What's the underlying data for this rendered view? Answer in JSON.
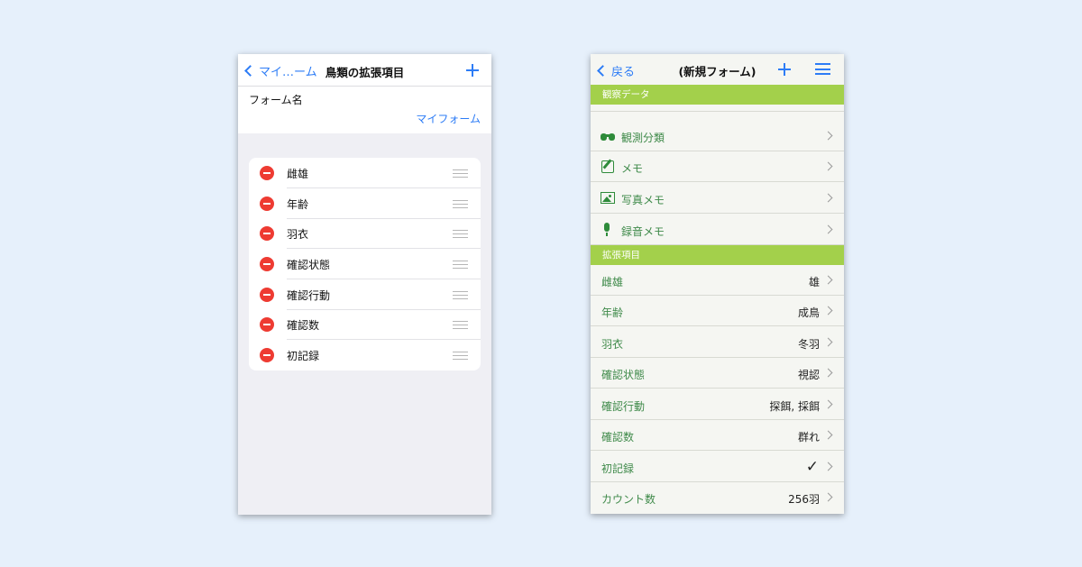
{
  "left": {
    "nav": {
      "back_label": "マイ…ーム",
      "title": "鳥類の拡張項目"
    },
    "form": {
      "label": "フォーム名",
      "value": "マイフォーム"
    },
    "items": [
      {
        "label": "雌雄"
      },
      {
        "label": "年齢"
      },
      {
        "label": "羽衣"
      },
      {
        "label": "確認状態"
      },
      {
        "label": "確認行動"
      },
      {
        "label": "確認数"
      },
      {
        "label": "初記録"
      }
    ]
  },
  "right": {
    "nav": {
      "back_label": "戻る",
      "title": "(新規フォーム)"
    },
    "section_observation": "観察データ",
    "obs_rows": [
      {
        "label": "観測分類",
        "icon": "binoculars-icon"
      },
      {
        "label": "メモ",
        "icon": "memo-icon"
      },
      {
        "label": "写真メモ",
        "icon": "photo-icon"
      },
      {
        "label": "録音メモ",
        "icon": "microphone-icon"
      }
    ],
    "section_extended": "拡張項目",
    "ext_rows": [
      {
        "label": "雌雄",
        "value": "雄"
      },
      {
        "label": "年齢",
        "value": "成鳥"
      },
      {
        "label": "羽衣",
        "value": "冬羽"
      },
      {
        "label": "確認状態",
        "value": "視認"
      },
      {
        "label": "確認行動",
        "value": "探餌, 採餌"
      },
      {
        "label": "確認数",
        "value": "群れ"
      },
      {
        "label": "初記録",
        "value": "✓"
      },
      {
        "label": "カウント数",
        "value": "256羽"
      }
    ]
  },
  "colors": {
    "accent": "#2d7cf6",
    "section_green": "#a3d04b",
    "label_green": "#3f8a4a",
    "delete_red": "#ee3b32"
  }
}
